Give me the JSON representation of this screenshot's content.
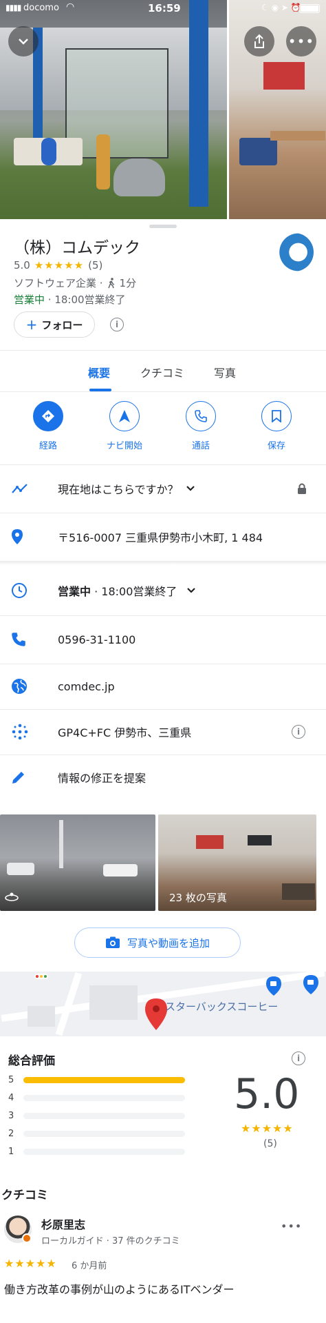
{
  "status_bar": {
    "carrier": "docomo",
    "time": "16:59"
  },
  "place": {
    "name": "（株）コムデック",
    "rating": "5.0",
    "stars": "★★★★★",
    "review_count": "(5)",
    "category": "ソフトウェア企業 ·",
    "walk_time": "1分",
    "open_status": "営業中",
    "hours": " · 18:00営業終了"
  },
  "follow": {
    "plus": "+",
    "label": "フォロー"
  },
  "tabs": [
    {
      "label": "概要"
    },
    {
      "label": "クチコミ"
    },
    {
      "label": "写真"
    }
  ],
  "actions": [
    {
      "label": "経路"
    },
    {
      "label": "ナビ開始"
    },
    {
      "label": "通話"
    },
    {
      "label": "保存"
    }
  ],
  "info": {
    "location_prompt": "現在地はこちらですか？",
    "address": "〒516-0007 三重県伊勢市小木町, 1 484",
    "hours_status": "営業中",
    "hours_close": " · 18:00営業終了",
    "phone": "0596-31-1100",
    "website": "comdec.jp",
    "plus_code": "GP4C+FC 伊勢市、三重県",
    "suggest_edit": "情報の修正を提案"
  },
  "photos": {
    "count_label": "23 枚の写真"
  },
  "add_photo": {
    "label": "写真や動画を追加"
  },
  "map": {
    "poi_label": "スターバックスコーヒー"
  },
  "ratings_summary": {
    "heading": "総合評価",
    "score": "5.0",
    "stars": "★★★★★",
    "count": "(5)",
    "distribution": [
      {
        "stars": "5",
        "fraction": 1.0
      },
      {
        "stars": "4",
        "fraction": 0.0
      },
      {
        "stars": "3",
        "fraction": 0.0
      },
      {
        "stars": "2",
        "fraction": 0.0
      },
      {
        "stars": "1",
        "fraction": 0.0
      }
    ]
  },
  "reviews": {
    "heading": "クチコミ",
    "items": [
      {
        "author": "杉原里志",
        "meta": "ローカルガイド · 37 件のクチコミ",
        "stars": "★★★★★",
        "time": "6 か月前",
        "text": "働き方改革の事例が山のようにあるITベンダー"
      }
    ]
  },
  "colors": {
    "accent": "#1a73e8",
    "star": "#f4b400",
    "open": "#188038"
  }
}
